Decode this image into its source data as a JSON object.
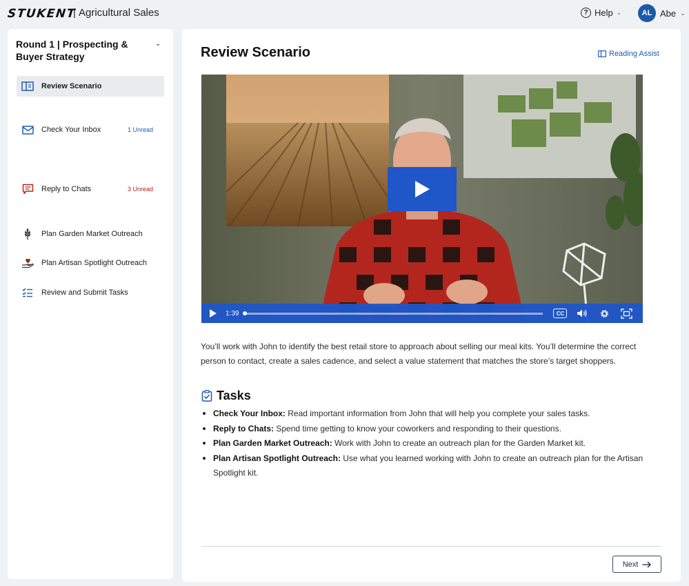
{
  "header": {
    "logo_text": "STUKENT",
    "separator": "|",
    "app_title": "Agricultural Sales",
    "help_label": "Help",
    "user_initials": "AL",
    "user_name": "Abe"
  },
  "sidebar": {
    "round_title": "Round 1 | Prospecting & Buyer Strategy",
    "items": [
      {
        "label": "Review Scenario",
        "badge": "",
        "icon": "book-open-icon",
        "active": true
      },
      {
        "label": "Check Your Inbox",
        "badge": "1 Unread",
        "icon": "mail-icon"
      },
      {
        "label": "Reply to Chats",
        "badge": "3 Unread",
        "icon": "chat-icon"
      },
      {
        "label": "Plan Garden Market Outreach",
        "badge": "",
        "icon": "wheat-icon"
      },
      {
        "label": "Plan Artisan Spotlight Outreach",
        "badge": "",
        "icon": "hand-heart-icon"
      },
      {
        "label": "Review and Submit Tasks",
        "badge": "",
        "icon": "checklist-icon"
      }
    ]
  },
  "main": {
    "title": "Review Scenario",
    "reading_assist": "Reading Assist",
    "video": {
      "time": "1:39",
      "cc_label": "CC",
      "progress": 0
    },
    "description": "You’ll work with John to identify the best retail store to approach about selling our meal kits. You’ll determine the correct person to contact, create a sales cadence, and select a value statement that matches the store’s target shoppers.",
    "tasks_title": "Tasks",
    "tasks": [
      {
        "name": "Check Your Inbox:",
        "text": " Read important information from John that will help you complete your sales tasks."
      },
      {
        "name": "Reply to Chats:",
        "text": " Spend time getting to know your coworkers and responding to their questions."
      },
      {
        "name": "Plan Garden Market Outreach:",
        "text": " Work with John to create an outreach plan for the Garden Market kit."
      },
      {
        "name": "Plan Artisan Spotlight Outreach:",
        "text": " Use what you learned working with John to create an outreach plan for the Artisan Spotlight kit."
      }
    ],
    "next_label": "Next"
  },
  "colors": {
    "accent": "#1d5ab5",
    "video_blue": "#1f56c8",
    "badge_red": "#b42318"
  }
}
